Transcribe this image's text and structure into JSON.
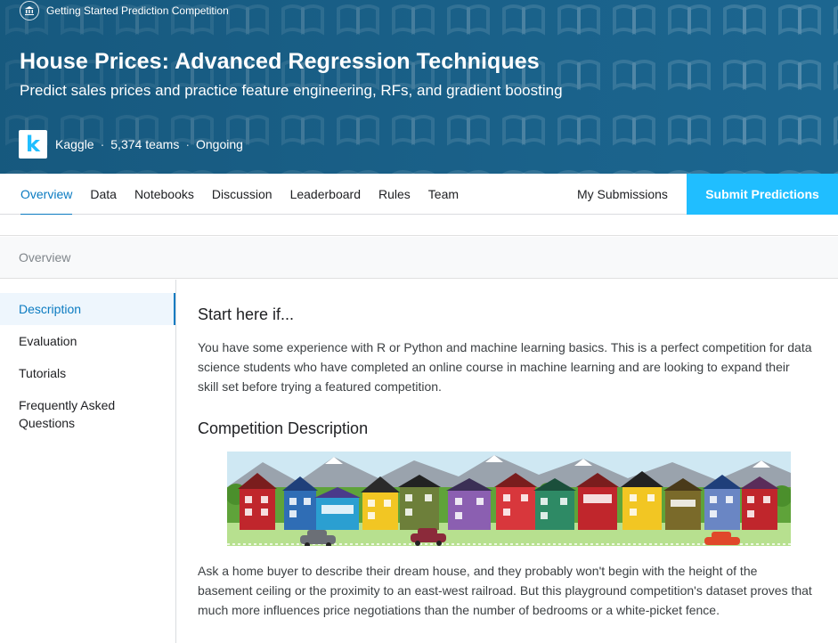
{
  "hero": {
    "kicker": "Getting Started Prediction Competition",
    "kicker_icon": "institution-icon",
    "title": "House Prices: Advanced Regression Techniques",
    "subtitle": "Predict sales prices and practice feature engineering, RFs, and gradient boosting",
    "host": "Kaggle",
    "teams": "5,374 teams",
    "status": "Ongoing",
    "separator": "·",
    "logo_letter": "k",
    "colors": {
      "background": "#1c6690",
      "logo_accent": "#20beff"
    }
  },
  "nav": {
    "tabs": [
      {
        "label": "Overview",
        "active": true
      },
      {
        "label": "Data"
      },
      {
        "label": "Notebooks"
      },
      {
        "label": "Discussion"
      },
      {
        "label": "Leaderboard"
      },
      {
        "label": "Rules"
      },
      {
        "label": "Team"
      }
    ],
    "my_submissions": "My Submissions",
    "submit": "Submit Predictions",
    "accent": "#0b7bc1"
  },
  "breadcrumb": "Overview",
  "sidebar": {
    "items": [
      {
        "label": "Description",
        "active": true
      },
      {
        "label": "Evaluation"
      },
      {
        "label": "Tutorials"
      },
      {
        "label": "Frequently Asked Questions"
      }
    ]
  },
  "content": {
    "start_heading": "Start here if...",
    "start_text": "You have some experience with R or Python and machine learning basics. This is a perfect competition for data science students who have completed an online course in machine learning and are looking to expand their skill set before trying a featured competition.",
    "desc_heading": "Competition Description",
    "desc_text": "Ask a home buyer to describe their dream house, and they probably won't begin with the height of the basement ceiling or the proximity to an east-west railroad. But this playground competition's dataset proves that much more influences price negotiations than the number of bedrooms or a white-picket fence."
  }
}
